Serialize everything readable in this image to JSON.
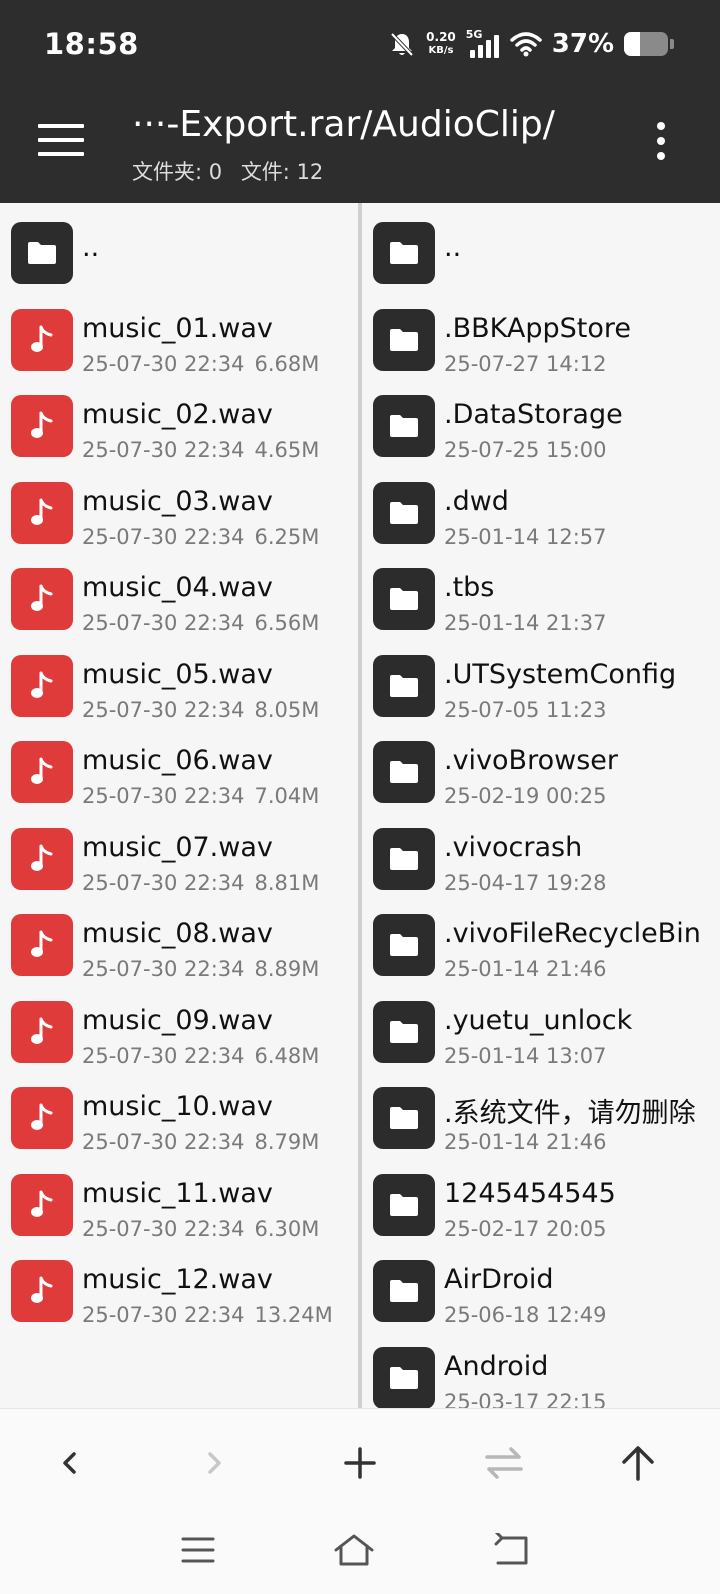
{
  "status": {
    "time": "18:58",
    "net_speed_value": "0.20",
    "net_speed_unit": "KB/s",
    "network_type": "5G",
    "battery_percent": "37%",
    "battery_level": 0.37
  },
  "header": {
    "path": "···-Export.rar/AudioClip/",
    "folders_label": "文件夹: 0",
    "files_label": "文件: 12"
  },
  "left_pane": {
    "up_label": "..",
    "items": [
      {
        "name": "music_01.wav",
        "date": "25-07-30 22:34",
        "size": "6.68M"
      },
      {
        "name": "music_02.wav",
        "date": "25-07-30 22:34",
        "size": "4.65M"
      },
      {
        "name": "music_03.wav",
        "date": "25-07-30 22:34",
        "size": "6.25M"
      },
      {
        "name": "music_04.wav",
        "date": "25-07-30 22:34",
        "size": "6.56M"
      },
      {
        "name": "music_05.wav",
        "date": "25-07-30 22:34",
        "size": "8.05M"
      },
      {
        "name": "music_06.wav",
        "date": "25-07-30 22:34",
        "size": "7.04M"
      },
      {
        "name": "music_07.wav",
        "date": "25-07-30 22:34",
        "size": "8.81M"
      },
      {
        "name": "music_08.wav",
        "date": "25-07-30 22:34",
        "size": "8.89M"
      },
      {
        "name": "music_09.wav",
        "date": "25-07-30 22:34",
        "size": "6.48M"
      },
      {
        "name": "music_10.wav",
        "date": "25-07-30 22:34",
        "size": "8.79M"
      },
      {
        "name": "music_11.wav",
        "date": "25-07-30 22:34",
        "size": "6.30M"
      },
      {
        "name": "music_12.wav",
        "date": "25-07-30 22:34",
        "size": "13.24M"
      }
    ]
  },
  "right_pane": {
    "up_label": "..",
    "items": [
      {
        "name": ".BBKAppStore",
        "date": "25-07-27 14:12"
      },
      {
        "name": ".DataStorage",
        "date": "25-07-25 15:00"
      },
      {
        "name": ".dwd",
        "date": "25-01-14 12:57"
      },
      {
        "name": ".tbs",
        "date": "25-01-14 21:37"
      },
      {
        "name": ".UTSystemConfig",
        "date": "25-07-05 11:23"
      },
      {
        "name": ".vivoBrowser",
        "date": "25-02-19 00:25"
      },
      {
        "name": ".vivocrash",
        "date": "25-04-17 19:28"
      },
      {
        "name": ".vivoFileRecycleBin",
        "date": "25-01-14 21:46"
      },
      {
        "name": ".yuetu_unlock",
        "date": "25-01-14 13:07"
      },
      {
        "name": ".系统文件，请勿删除",
        "date": "25-01-14 21:46"
      },
      {
        "name": "1245454545",
        "date": "25-02-17 20:05"
      },
      {
        "name": "AirDroid",
        "date": "25-06-18 12:49"
      },
      {
        "name": "Android",
        "date": "25-03-17 22:15"
      }
    ]
  },
  "toolbar": {
    "icons": [
      "back-icon",
      "forward-icon",
      "add-icon",
      "swap-icon",
      "up-icon"
    ]
  },
  "navbar": {
    "icons": [
      "menu-icon",
      "home-icon",
      "return-icon"
    ]
  },
  "colors": {
    "header_bg": "#2d2d2d",
    "music_icon": "#e03b3b",
    "folder_icon": "#2c2c2c"
  }
}
